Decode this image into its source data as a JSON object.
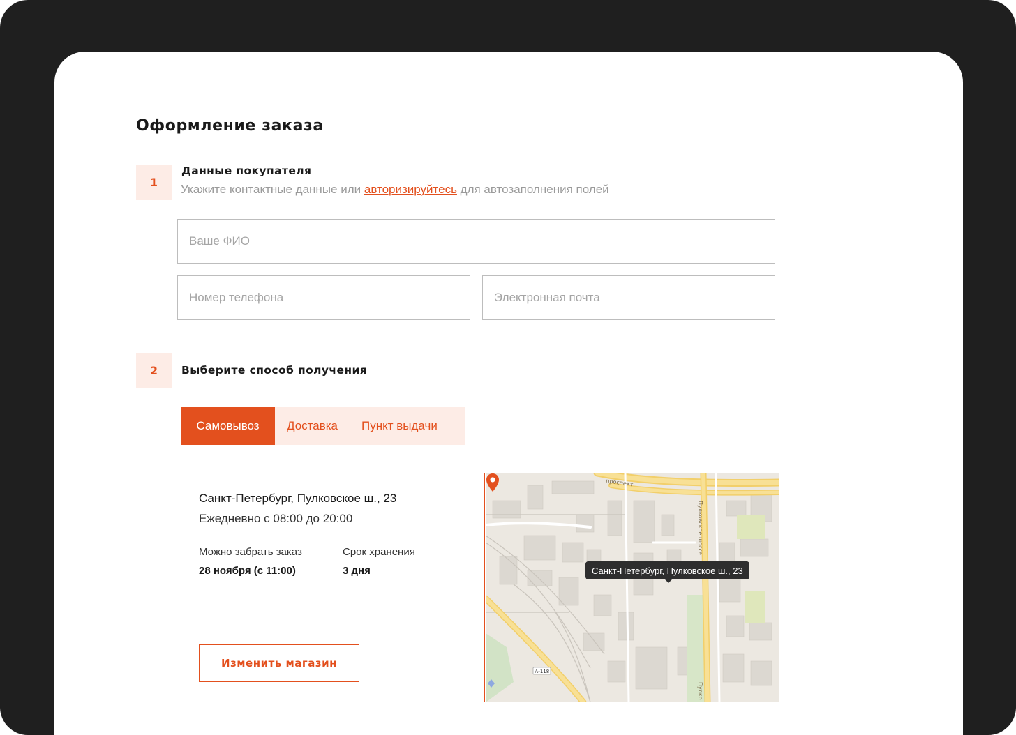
{
  "page": {
    "title": "Оформление заказа"
  },
  "steps": [
    {
      "number": "1",
      "title": "Данные покупателя",
      "subtitle_before": "Укажите контактные данные или ",
      "subtitle_link": "авторизируйтесь",
      "subtitle_after": " для автозаполнения полей"
    },
    {
      "number": "2",
      "title": "Выберите способ получения"
    }
  ],
  "form": {
    "name_placeholder": "Ваше ФИО",
    "phone_placeholder": "Номер телефона",
    "email_placeholder": "Электронная почта"
  },
  "delivery_tabs": [
    {
      "label": "Самовывоз",
      "active": true
    },
    {
      "label": "Доставка",
      "active": false
    },
    {
      "label": "Пункт выдачи",
      "active": false
    }
  ],
  "store": {
    "address": "Санкт-Петербург, Пулковское ш., 23",
    "hours": "Ежедневно с 08:00 до 20:00",
    "pickup_label": "Можно забрать заказ",
    "pickup_value": "28 ноября (с 11:00)",
    "storage_label": "Срок хранения",
    "storage_value": "3 дня",
    "change_button": "Изменить магазин"
  },
  "map": {
    "tooltip": "Санкт-Петербург, Пулковское ш., 23",
    "road_label_top": "проспект",
    "road_label_vertical": "Пулковское шоссе",
    "road_label_bottom": "Пулко",
    "road_badge": "А-118"
  },
  "colors": {
    "accent": "#e3501e",
    "accent_light": "#fdece6",
    "frame": "#1f1f1f"
  }
}
